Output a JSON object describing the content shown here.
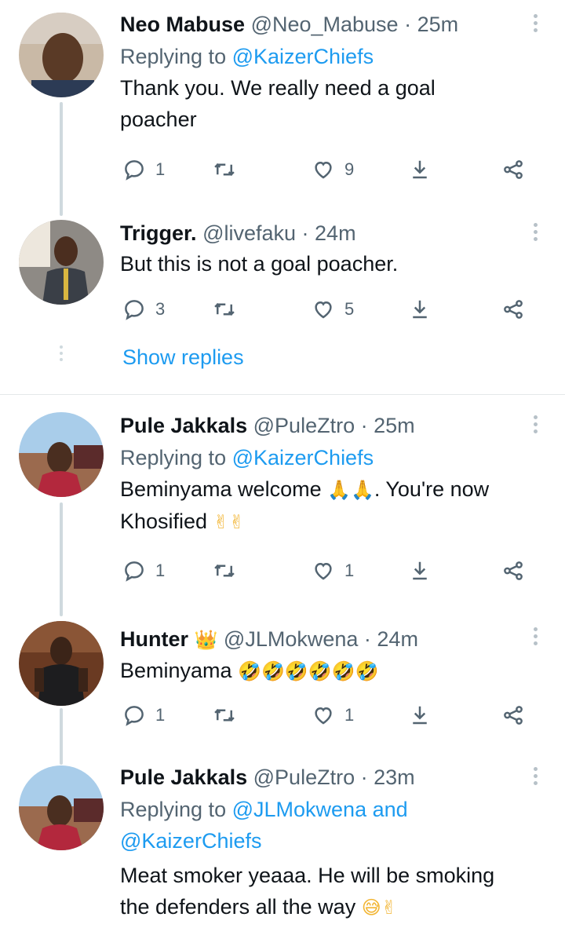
{
  "tweets": [
    {
      "name": "Neo Mabuse",
      "handle": "@Neo_Mabuse",
      "time": "· 25m",
      "replying_label": "Replying to",
      "replying_to": "@KaizerChiefs",
      "replying_to_2": "",
      "text_line1": "Thank you. We really need a goal",
      "text_line2": "poacher",
      "replies": "1",
      "retweets": "",
      "likes": "9"
    },
    {
      "name": "Trigger.",
      "handle": "@livefaku",
      "time": "· 24m",
      "text_line1": "But this is not a goal poacher.",
      "replies": "3",
      "retweets": "",
      "likes": "5"
    },
    {
      "name": "Pule Jakkals",
      "handle": "@PuleZtro",
      "time": "· 25m",
      "replying_label": "Replying to",
      "replying_to": "@KaizerChiefs",
      "text_line1": "Beminyama welcome",
      "text_line1_emoji": "🙏🙏",
      "text_line1_tail": ". You're now",
      "text_line2": "Khosified",
      "text_line2_emoji": "✌✌",
      "replies": "1",
      "retweets": "",
      "likes": "1"
    },
    {
      "name": "Hunter",
      "name_emoji": "👑",
      "handle": "@JLMokwena",
      "time": "· 24m",
      "text_line1": "Beminyama",
      "text_line1_emoji": "🤣🤣🤣🤣🤣🤣",
      "replies": "1",
      "retweets": "",
      "likes": "1"
    },
    {
      "name": "Pule Jakkals",
      "handle": "@PuleZtro",
      "time": "· 23m",
      "replying_label": "Replying to",
      "replying_to": "@JLMokwena",
      "replying_and": "and",
      "replying_to_2": "@KaizerChiefs",
      "text_line1": "Meat smoker yeaaa. He will be smoking",
      "text_line2": "the defenders all the way",
      "text_line2_emoji": "😅✌",
      "replies": "",
      "retweets": "",
      "likes": ""
    }
  ],
  "show_replies": "Show replies",
  "colors": {
    "link": "#1d9bf0",
    "muted": "#536471",
    "text": "#0f1419",
    "line": "#cfd9de"
  },
  "icons": [
    "reply-icon",
    "retweet-icon",
    "like-icon",
    "share-icon",
    "more-icon"
  ]
}
